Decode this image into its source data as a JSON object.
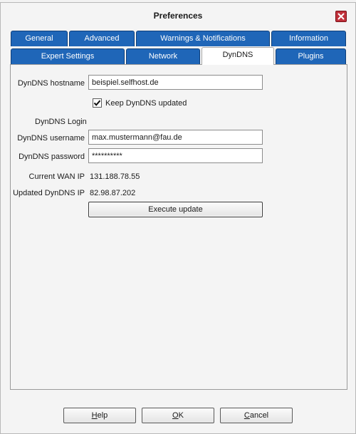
{
  "window": {
    "title": "Preferences",
    "title_bar_colors": {
      "background": "#f4f4f4",
      "close": "#c0303a"
    }
  },
  "tabs": {
    "colors": {
      "inactive": "#1f66b8",
      "active": "#ffffff",
      "inactive_text": "#ffffff"
    },
    "row1": [
      {
        "label": "General"
      },
      {
        "label": "Advanced"
      },
      {
        "label": "Warnings & Notifications"
      },
      {
        "label": "Information"
      }
    ],
    "row2": [
      {
        "label": "Expert Settings"
      },
      {
        "label": "Network"
      },
      {
        "label": "DynDNS",
        "active": true
      },
      {
        "label": "Plugins"
      }
    ]
  },
  "dyndns": {
    "hostname_label": "DynDNS hostname",
    "hostname_value": "beispiel.selfhost.de",
    "keep_updated_label": "Keep DynDNS updated",
    "keep_updated_checked": true,
    "login_heading": "DynDNS Login",
    "username_label": "DynDNS username",
    "username_value": "max.mustermann@fau.de",
    "password_label": "DynDNS password",
    "password_value": "**********",
    "current_wan_ip_label": "Current WAN IP",
    "current_wan_ip_value": "131.188.78.55",
    "updated_ip_label": "Updated DynDNS IP",
    "updated_ip_value": "82.98.87.202",
    "execute_label": "Execute update"
  },
  "footer": {
    "help": {
      "mnemonic": "H",
      "rest": "elp"
    },
    "ok": {
      "mnemonic": "O",
      "rest": "K"
    },
    "cancel": {
      "mnemonic": "C",
      "rest": "ancel"
    }
  }
}
